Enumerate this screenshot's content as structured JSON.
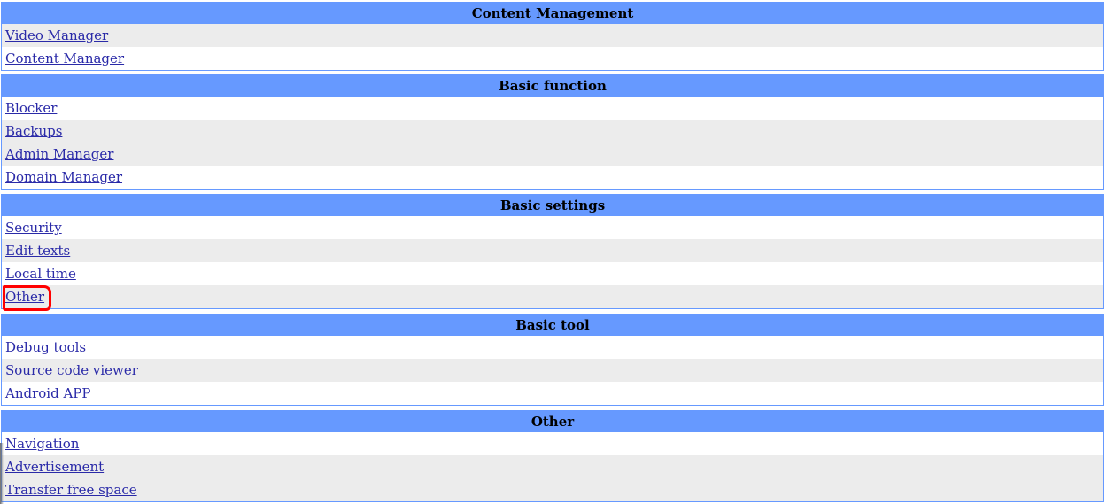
{
  "colors": {
    "header_bg": "#6699ff",
    "row_alt": "#ececec",
    "link": "#2a2aa8",
    "highlight": "#ff0000"
  },
  "sections": [
    {
      "title": "Content Management",
      "items": [
        "Video Manager",
        "Content Manager"
      ]
    },
    {
      "title": "Basic function",
      "items": [
        "Blocker",
        "Backups",
        "Admin Manager",
        "Domain Manager"
      ]
    },
    {
      "title": "Basic settings",
      "items": [
        "Security",
        "Edit texts",
        "Local time",
        "Other"
      ]
    },
    {
      "title": "Basic tool",
      "items": [
        "Debug tools",
        "Source code viewer",
        "Android APP"
      ]
    },
    {
      "title": "Other",
      "items": [
        "Navigation",
        "Advertisement",
        "Transfer free space"
      ]
    }
  ]
}
